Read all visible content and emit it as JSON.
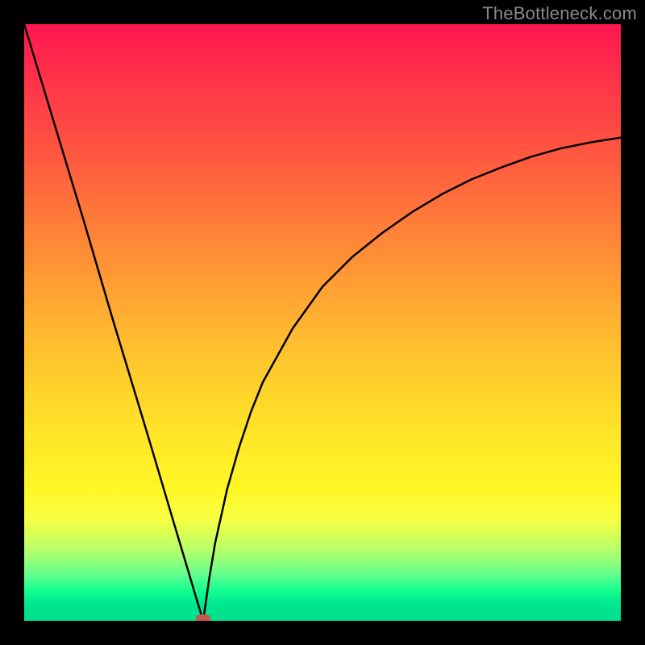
{
  "watermark": "TheBottleneck.com",
  "colors": {
    "frame": "#000000",
    "curve": "#000000",
    "marker": "#c25b4f",
    "gradient_top": "#ff1650",
    "gradient_bottom": "#00df8e"
  },
  "chart_data": {
    "type": "line",
    "title": "",
    "xlabel": "",
    "ylabel": "",
    "xlim": [
      0,
      100
    ],
    "ylim": [
      0,
      100
    ],
    "grid": false,
    "legend": false,
    "background": "vertical rainbow gradient red→yellow→green",
    "note": "V-shaped bottleneck curve with minimum at x≈30; left branch steep/near-linear, right branch concave approaching ~81",
    "series": [
      {
        "name": "left-branch",
        "x": [
          0,
          5,
          10,
          15,
          20,
          22,
          25,
          27,
          29,
          30
        ],
        "y": [
          100,
          83.5,
          67,
          50,
          33.5,
          26.8,
          16.7,
          10,
          3.3,
          0
        ]
      },
      {
        "name": "right-branch",
        "x": [
          30,
          31,
          32,
          34,
          36,
          38,
          40,
          45,
          50,
          55,
          60,
          65,
          70,
          75,
          80,
          85,
          90,
          95,
          100
        ],
        "y": [
          0,
          7,
          13,
          22,
          29,
          35,
          40,
          49,
          56,
          61,
          65,
          68.5,
          71.5,
          74,
          76,
          77.8,
          79.2,
          80.2,
          81
        ]
      }
    ],
    "marker": {
      "x": 30,
      "y": 0,
      "shape": "rounded-rect"
    }
  }
}
